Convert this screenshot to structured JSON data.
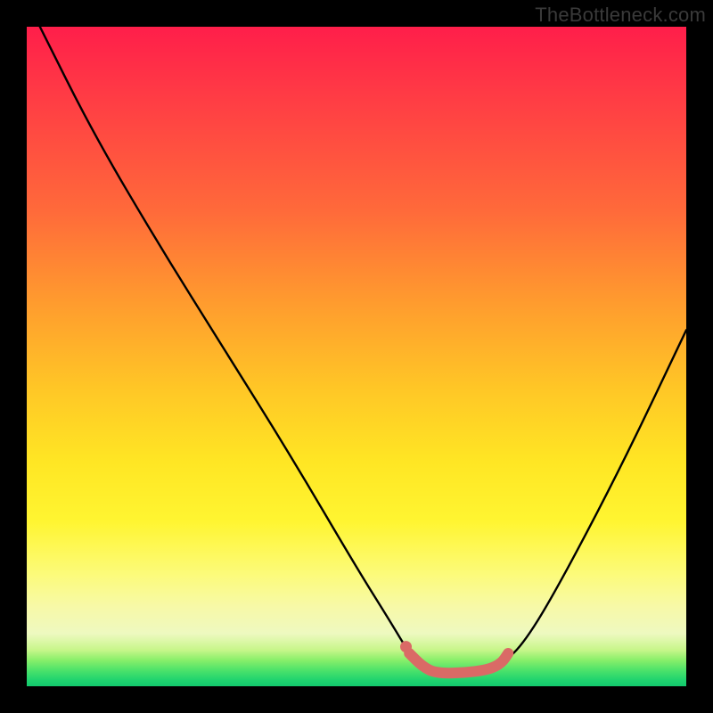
{
  "watermark": "TheBottleneck.com",
  "chart_data": {
    "type": "line",
    "title": "",
    "xlabel": "",
    "ylabel": "",
    "xlim": [
      0,
      100
    ],
    "ylim": [
      0,
      100
    ],
    "grid": false,
    "series": [
      {
        "name": "bottleneck-curve",
        "color": "#000000",
        "x": [
          2,
          10,
          20,
          30,
          40,
          50,
          55,
          58,
          60,
          62,
          66,
          70,
          72,
          75,
          80,
          90,
          100
        ],
        "y": [
          100,
          84,
          67,
          51,
          35,
          18,
          10,
          5,
          3,
          2,
          2,
          2.5,
          3.5,
          6,
          14,
          33,
          54
        ]
      },
      {
        "name": "optimal-segment",
        "color": "#da6a66",
        "x": [
          58,
          60,
          62,
          66,
          70,
          72,
          73
        ],
        "y": [
          5,
          3,
          2,
          2,
          2.5,
          3.5,
          5
        ]
      }
    ],
    "annotations": [
      {
        "name": "optimal-start-dot",
        "x": 57.5,
        "y": 6,
        "color": "#da6a66"
      }
    ],
    "gradient_stops": [
      {
        "pct": 0,
        "color": "#ff1e4a"
      },
      {
        "pct": 28,
        "color": "#ff6a3a"
      },
      {
        "pct": 55,
        "color": "#ffc726"
      },
      {
        "pct": 75,
        "color": "#fff531"
      },
      {
        "pct": 92,
        "color": "#eef9c0"
      },
      {
        "pct": 100,
        "color": "#12c96d"
      }
    ]
  }
}
